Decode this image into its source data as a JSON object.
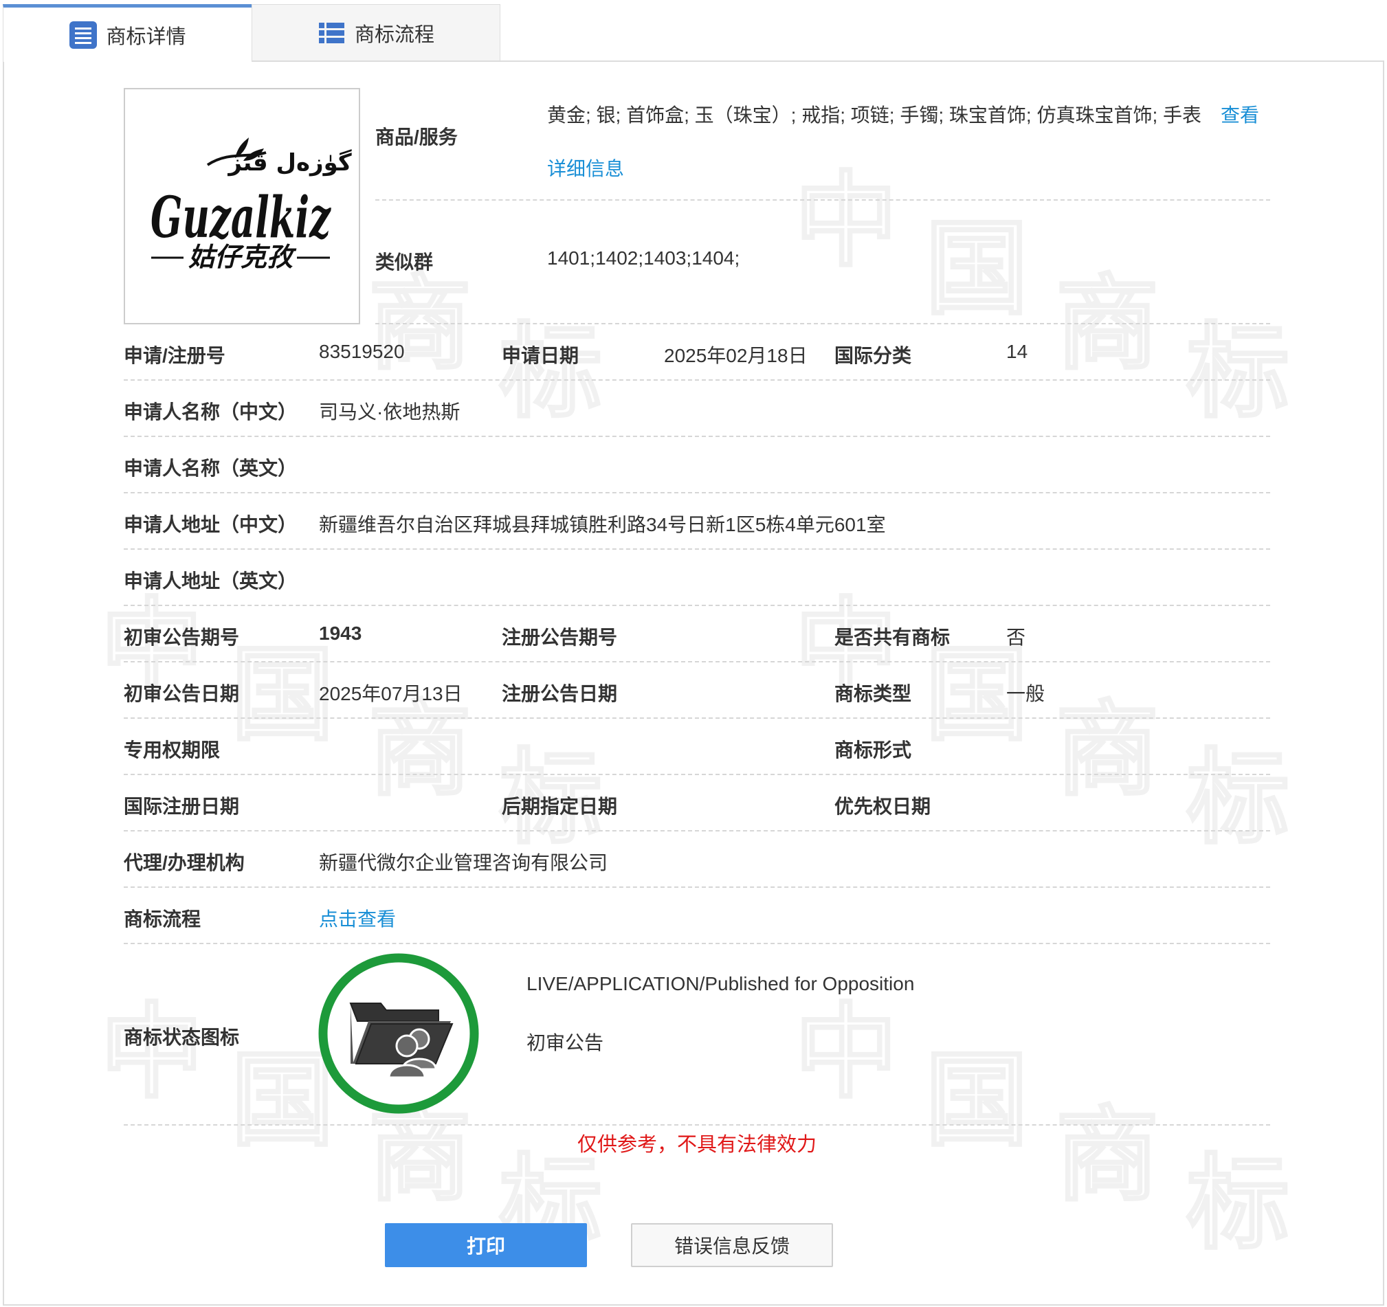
{
  "tabs": [
    {
      "label": "商标详情",
      "icon": "list-detail-icon",
      "active": true
    },
    {
      "label": "商标流程",
      "icon": "list-flow-icon",
      "active": false
    }
  ],
  "logo": {
    "latin_text": "Guzalkiz",
    "chinese_text": "姑仔克孜",
    "arabic_text": "گۈزەل قىز"
  },
  "goods": {
    "label": "商品/服务",
    "value": "黄金; 银; 首饰盒; 玉（珠宝）; 戒指; 项链; 手镯; 珠宝首饰; 仿真珠宝首饰; 手表",
    "view_link": "查看",
    "detail_link": "详细信息"
  },
  "similar_group": {
    "label": "类似群",
    "value": "1401;1402;1403;1404;"
  },
  "fields": {
    "reg_no": {
      "label": "申请/注册号",
      "value": "83519520"
    },
    "apply_date": {
      "label": "申请日期",
      "value": "2025年02月18日"
    },
    "intl_class": {
      "label": "国际分类",
      "value": "14"
    },
    "applicant_cn": {
      "label": "申请人名称（中文）",
      "value": "司马义·依地热斯"
    },
    "applicant_en": {
      "label": "申请人名称（英文）",
      "value": ""
    },
    "address_cn": {
      "label": "申请人地址（中文）",
      "value": "新疆维吾尔自治区拜城县拜城镇胜利路34号日新1区5栋4单元601室"
    },
    "address_en": {
      "label": "申请人地址（英文）",
      "value": ""
    },
    "prelim_issue": {
      "label": "初审公告期号",
      "value": "1943"
    },
    "reg_issue": {
      "label": "注册公告期号",
      "value": ""
    },
    "shared_mark": {
      "label": "是否共有商标",
      "value": "否"
    },
    "prelim_date": {
      "label": "初审公告日期",
      "value": "2025年07月13日"
    },
    "reg_date": {
      "label": "注册公告日期",
      "value": ""
    },
    "mark_type": {
      "label": "商标类型",
      "value": "一般"
    },
    "exclusive_period": {
      "label": "专用权期限",
      "value": ""
    },
    "mark_form": {
      "label": "商标形式",
      "value": ""
    },
    "intl_reg_date": {
      "label": "国际注册日期",
      "value": ""
    },
    "later_date": {
      "label": "后期指定日期",
      "value": ""
    },
    "priority_date": {
      "label": "优先权日期",
      "value": ""
    },
    "agency": {
      "label": "代理/办理机构",
      "value": "新疆代微尔企业管理咨询有限公司"
    },
    "flow": {
      "label": "商标流程",
      "link": "点击查看"
    }
  },
  "status": {
    "label": "商标状态图标",
    "line1": "LIVE/APPLICATION/Published for Opposition",
    "line2": "初审公告",
    "ring_color": "#1d9a3a"
  },
  "disclaimer": "仅供参考，不具有法律效力",
  "buttons": {
    "print": "打印",
    "feedback": "错误信息反馈"
  },
  "colors": {
    "accent": "#3d8ee8",
    "link": "#1a8fd6",
    "warning": "#e01818"
  }
}
